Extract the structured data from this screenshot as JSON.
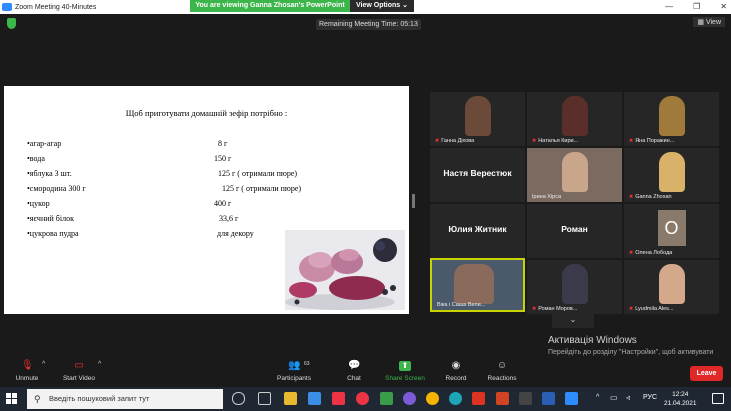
{
  "window": {
    "title": "Zoom Meeting 40-Minutes"
  },
  "share_banner": {
    "message": "You are viewing Ganna Zhosan's PowerPoint",
    "view_options": "View Options ⌄"
  },
  "meeting": {
    "remaining": "Remaining Meeting Time: 05:13",
    "view_label": "View"
  },
  "slide": {
    "title": "Щоб приготувати домашній зефір потрібно :",
    "ingredients": [
      {
        "name": "•агар-агар",
        "amount": "8 г"
      },
      {
        "name": "•вода",
        "amount": "150 г"
      },
      {
        "name": "•яблука 3 шт.",
        "amount": "125 г ( отримали пюре)"
      },
      {
        "name": "•смородина 300 г",
        "amount": "125 г ( отримали пюре)"
      },
      {
        "name": "•цукор",
        "amount": "400 г"
      },
      {
        "name": "•яєчний білок",
        "amount": "33,6 г"
      },
      {
        "name": "•цукрова пудра",
        "amount": "для декору"
      }
    ]
  },
  "participants_grid": [
    {
      "name": "Ганна Діхова",
      "type": "video",
      "muted": true
    },
    {
      "name": "Наталья Кири...",
      "type": "video",
      "muted": true
    },
    {
      "name": "Яна Поражин...",
      "type": "video",
      "muted": true
    },
    {
      "name": "Настя Верестюк",
      "type": "name"
    },
    {
      "name": "Ірина Хірса",
      "type": "video",
      "muted": false
    },
    {
      "name": "Ganna Zhosan",
      "type": "video",
      "muted": true
    },
    {
      "name": "Юлия Житник",
      "type": "name"
    },
    {
      "name": "Роман",
      "type": "name"
    },
    {
      "name": "Олена Лобода",
      "type": "avatar",
      "initial": "О",
      "muted": true
    },
    {
      "name": "Віка і Саша Вели...",
      "type": "video",
      "muted": false,
      "active": true
    },
    {
      "name": "Роман Моров...",
      "type": "video",
      "muted": true
    },
    {
      "name": "Lyudmila Ales...",
      "type": "video",
      "muted": true
    }
  ],
  "activation": {
    "title": "Активація Windows",
    "body": "Перейдіть до розділу \"Настройки\", щоб активувати Windows."
  },
  "toolbar": {
    "unmute": "Unmute",
    "start_video": "Start Video",
    "participants": "Participants",
    "participants_count": "63",
    "chat": "Chat",
    "share_screen": "Share Screen",
    "record": "Record",
    "reactions": "Reactions",
    "leave": "Leave"
  },
  "taskbar": {
    "search_placeholder": "Введіть пошуковий запит тут",
    "language": "РУС",
    "time": "12:24",
    "date": "21.04.2021"
  }
}
